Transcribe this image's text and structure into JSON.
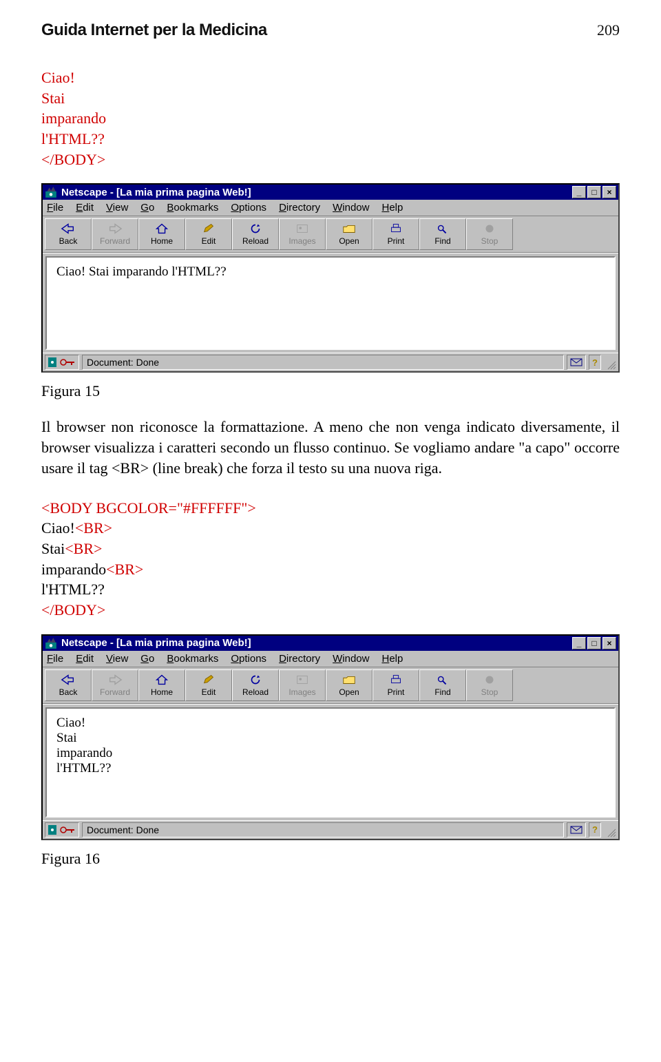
{
  "header": {
    "title": "Guida Internet per la Medicina",
    "page": "209"
  },
  "code1": {
    "l1": "Ciao!",
    "l2": "Stai",
    "l3": "imparando",
    "l4": "l'HTML??",
    "l5": "</BODY>"
  },
  "fig15": {
    "caption": "Figura 15",
    "title": "Netscape - [La mia prima pagina Web!]",
    "content": "Ciao! Stai imparando l'HTML??",
    "status": "Document: Done"
  },
  "para1": "Il browser non riconosce la formattazione. A meno che non venga indicato diversamente, il browser visualizza i caratteri secondo un flusso continuo. Se vogliamo andare \"a capo\" occorre usare il tag <BR> (line break) che forza il testo su una nuova riga.",
  "code2": {
    "l1": "<BODY BGCOLOR=\"#FFFFFF\">",
    "l2a": "Ciao!",
    "l2b": "<BR>",
    "l3a": "Stai",
    "l3b": "<BR>",
    "l4a": "imparando",
    "l4b": "<BR>",
    "l5": "l'HTML??",
    "l6": "</BODY>"
  },
  "fig16": {
    "caption": "Figura 16",
    "title": "Netscape - [La mia prima pagina Web!]",
    "c1": "Ciao!",
    "c2": "Stai",
    "c3": "imparando",
    "c4": "l'HTML??",
    "status": "Document: Done"
  },
  "menu": {
    "file": "File",
    "edit": "Edit",
    "view": "View",
    "go": "Go",
    "bookmarks": "Bookmarks",
    "options": "Options",
    "directory": "Directory",
    "window": "Window",
    "help": "Help"
  },
  "toolbar": {
    "back": "Back",
    "forward": "Forward",
    "home": "Home",
    "editbtn": "Edit",
    "reload": "Reload",
    "images": "Images",
    "open": "Open",
    "print": "Print",
    "find": "Find",
    "stop": "Stop"
  },
  "winbtn": {
    "min": "_",
    "max": "□",
    "close": "×"
  }
}
